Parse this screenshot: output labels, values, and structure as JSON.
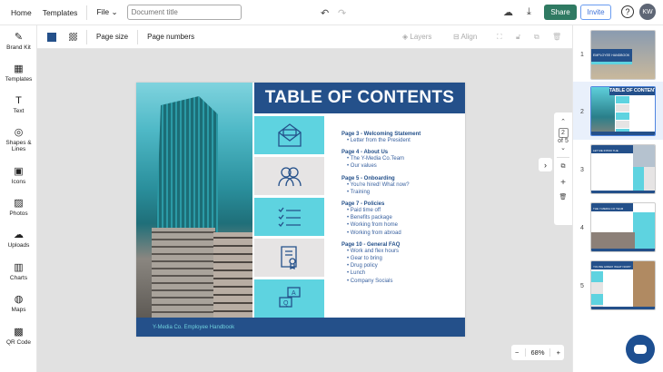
{
  "topbar": {
    "home": "Home",
    "templates": "Templates",
    "file": "File",
    "title_placeholder": "Document title",
    "share": "Share",
    "invite": "Invite",
    "help": "?",
    "avatar": "KW"
  },
  "sidebar": {
    "items": [
      {
        "label": "Brand Kit",
        "icon": "✎"
      },
      {
        "label": "Templates",
        "icon": "▦"
      },
      {
        "label": "Text",
        "icon": "T"
      },
      {
        "label": "Shapes & Lines",
        "icon": "◎"
      },
      {
        "label": "Icons",
        "icon": "▣"
      },
      {
        "label": "Photos",
        "icon": "▨"
      },
      {
        "label": "Uploads",
        "icon": "☁"
      },
      {
        "label": "Charts",
        "icon": "▥"
      },
      {
        "label": "Maps",
        "icon": "◍"
      },
      {
        "label": "QR Code",
        "icon": "▩"
      }
    ]
  },
  "toolbar": {
    "page_size": "Page size",
    "page_numbers": "Page numbers",
    "layers": "Layers",
    "align": "Align",
    "bg_color": "#24508a"
  },
  "slide": {
    "title": "TABLE OF CONTENTS",
    "sections": [
      {
        "heading": "Page 3 - Welcoming Statement",
        "items": [
          "Letter from the President"
        ]
      },
      {
        "heading": "Page 4 - About Us",
        "items": [
          "The Y-Media Co.Team",
          "Our values"
        ]
      },
      {
        "heading": "Page 5 - Onboarding",
        "items": [
          "You're hired! What now?",
          "Training"
        ]
      },
      {
        "heading": "Page 7 - Policies",
        "items": [
          "Paid time off",
          "Benefits package",
          "Working from home",
          "Working from abroad"
        ]
      },
      {
        "heading": "Page 10 - General FAQ",
        "items": [
          "Work and flex hours",
          "Gear to bring",
          "Drug policy",
          "Lunch",
          "Company Socials"
        ]
      }
    ],
    "footer": "Y-Media Co. Employee Handbook",
    "colors": {
      "navy": "#24508a",
      "teal": "#5ed3e0",
      "gray": "#e6e4e4"
    }
  },
  "pagenav": {
    "current": "2",
    "of": "of 5"
  },
  "zoom": {
    "minus": "−",
    "value": "68%",
    "plus": "+"
  },
  "pages": {
    "numbers": [
      "1",
      "2",
      "3",
      "4",
      "5"
    ],
    "selected": "2",
    "thumb1_title": "EMPLOYEE HANDBOOK",
    "thumb2_title": "TABLE OF CONTENTS",
    "thumb3_title": "LET ME INTRO THE PRESIDENT",
    "thumb4_title": "THE Y-MEDIA CO TEAM",
    "thumb5_title": "YOU'RE HIRED! WHAT NOW?"
  }
}
